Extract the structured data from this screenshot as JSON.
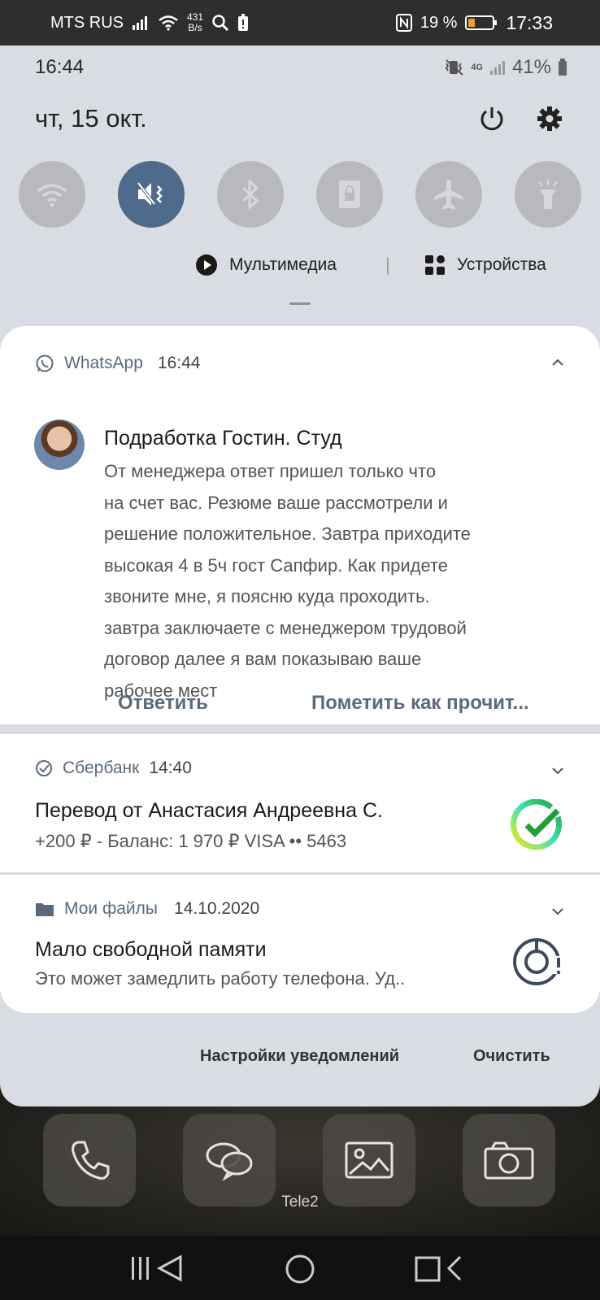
{
  "outer_status": {
    "carrier": "MTS RUS",
    "speed_value": "431",
    "speed_unit": "B/s",
    "battery": "19 %",
    "time": "17:33"
  },
  "inner_status": {
    "time": "16:44",
    "network": "4G",
    "battery": "41%"
  },
  "shade": {
    "date": "чт, 15 окт.",
    "media_label": "Мультимедиа",
    "devices_label": "Устройства"
  },
  "whatsapp": {
    "app": "WhatsApp",
    "time": "16:44",
    "title": "Подработка Гостин. Студ",
    "lines": [
      "От менеджера ответ пришел только что",
      "на счет вас. Резюме ваше рассмотрели и",
      "решение положительное. Завтра приходите",
      "высокая 4 в 5ч гост Сапфир. Как придете",
      "звоните мне, я поясню куда проходить.",
      "завтра заключаете с менеджером трудовой",
      "договор далее я вам показываю ваше",
      "рабочее мест"
    ],
    "reply": "Ответить",
    "mark_read": "Пометить как прочит..."
  },
  "sberbank": {
    "app": "Сбербанк",
    "time": "14:40",
    "title": "Перевод от Анастасия Андреевна С.",
    "text": "+200 ₽ - Баланс: 1 970 ₽ VISA •• 5463"
  },
  "myfiles": {
    "app": "Мои файлы",
    "time": "14.10.2020",
    "title": "Мало свободной памяти",
    "text": "Это может замедлить работу телефона. Уд.."
  },
  "footer": {
    "settings": "Настройки уведомлений",
    "clear": "Очистить"
  },
  "home": {
    "carrier": "Tele2"
  },
  "colors": {
    "accent": "#4f6b8b",
    "shade_bg": "#d9dce2",
    "action_text": "#5a6a7d"
  }
}
